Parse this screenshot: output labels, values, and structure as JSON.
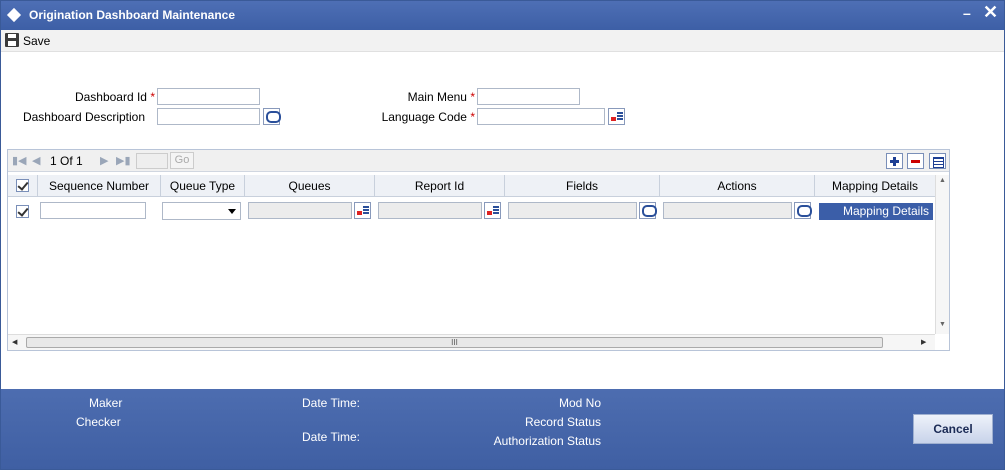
{
  "window": {
    "title": "Origination Dashboard Maintenance",
    "minimize": "–",
    "close": "✕"
  },
  "toolbar": {
    "save_label": "Save"
  },
  "form": {
    "dashboard_id_label": "Dashboard Id",
    "dashboard_desc_label": "Dashboard Description",
    "main_menu_label": "Main Menu",
    "language_code_label": "Language Code",
    "required_mark": "*",
    "dashboard_id_value": "",
    "dashboard_desc_value": "",
    "main_menu_value": "",
    "language_code_value": ""
  },
  "grid": {
    "page_info": "1 Of 1",
    "go_label": "Go",
    "columns": [
      "Sequence Number",
      "Queue Type",
      "Queues",
      "Report Id",
      "Fields",
      "Actions",
      "Mapping Details"
    ],
    "row": {
      "sequence_number": "",
      "queue_type": "",
      "mapping_details": "Mapping Details"
    },
    "scroll_grip": "III"
  },
  "footer": {
    "maker": "Maker",
    "checker": "Checker",
    "date_time_1": "Date Time:",
    "date_time_2": "Date Time:",
    "mod_no": "Mod No",
    "record_status": "Record Status",
    "authorization_status": "Authorization Status",
    "cancel_label": "Cancel"
  }
}
